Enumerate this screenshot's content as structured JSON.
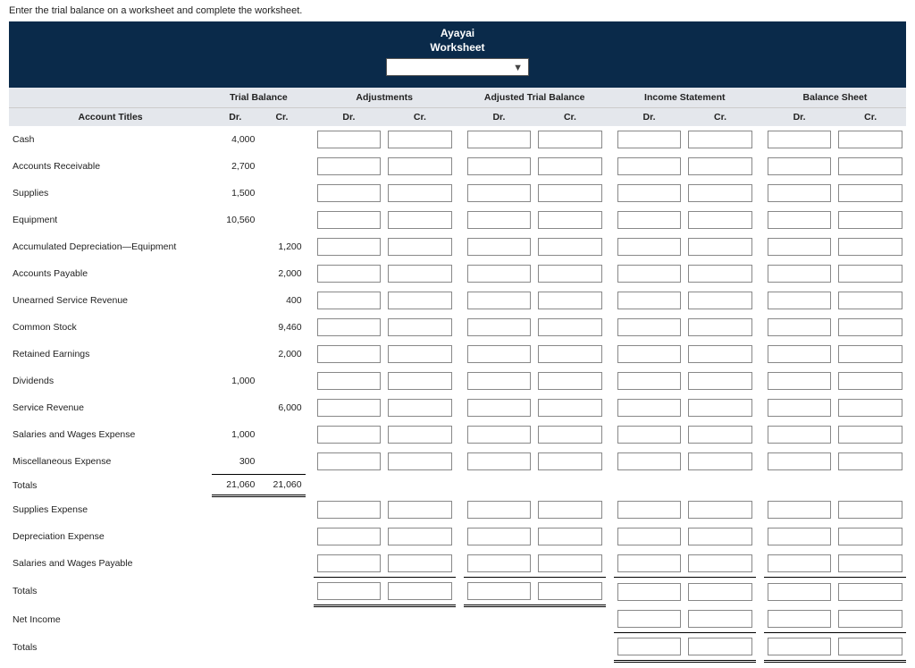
{
  "instruction": "Enter the trial balance on a worksheet and complete the worksheet.",
  "header": {
    "line1": "Ayayai",
    "line2": "Worksheet"
  },
  "group_headers": {
    "trial_balance": "Trial Balance",
    "adjustments": "Adjustments",
    "adjusted_tb": "Adjusted Trial Balance",
    "income_stmt": "Income Statement",
    "balance_sheet": "Balance Sheet"
  },
  "sub_headers": {
    "account_titles": "Account Titles",
    "dr": "Dr.",
    "cr": "Cr."
  },
  "rows": [
    {
      "title": "Cash",
      "tb_dr": "4,000",
      "tb_cr": ""
    },
    {
      "title": "Accounts Receivable",
      "tb_dr": "2,700",
      "tb_cr": ""
    },
    {
      "title": "Supplies",
      "tb_dr": "1,500",
      "tb_cr": ""
    },
    {
      "title": "Equipment",
      "tb_dr": "10,560",
      "tb_cr": ""
    },
    {
      "title": "Accumulated Depreciation—Equipment",
      "tb_dr": "",
      "tb_cr": "1,200"
    },
    {
      "title": "Accounts Payable",
      "tb_dr": "",
      "tb_cr": "2,000"
    },
    {
      "title": "Unearned Service Revenue",
      "tb_dr": "",
      "tb_cr": "400"
    },
    {
      "title": "Common Stock",
      "tb_dr": "",
      "tb_cr": "9,460"
    },
    {
      "title": "Retained Earnings",
      "tb_dr": "",
      "tb_cr": "2,000"
    },
    {
      "title": "Dividends",
      "tb_dr": "1,000",
      "tb_cr": ""
    },
    {
      "title": "Service Revenue",
      "tb_dr": "",
      "tb_cr": "6,000"
    },
    {
      "title": "Salaries and Wages Expense",
      "tb_dr": "1,000",
      "tb_cr": ""
    },
    {
      "title": "Miscellaneous Expense",
      "tb_dr": "300",
      "tb_cr": ""
    }
  ],
  "totals1": {
    "label": "Totals",
    "dr": "21,060",
    "cr": "21,060"
  },
  "extra_rows": [
    {
      "title": "Supplies Expense"
    },
    {
      "title": "Depreciation Expense"
    },
    {
      "title": "Salaries and Wages Payable"
    }
  ],
  "totals2_label": "Totals",
  "net_income_label": "Net Income",
  "totals3_label": "Totals"
}
